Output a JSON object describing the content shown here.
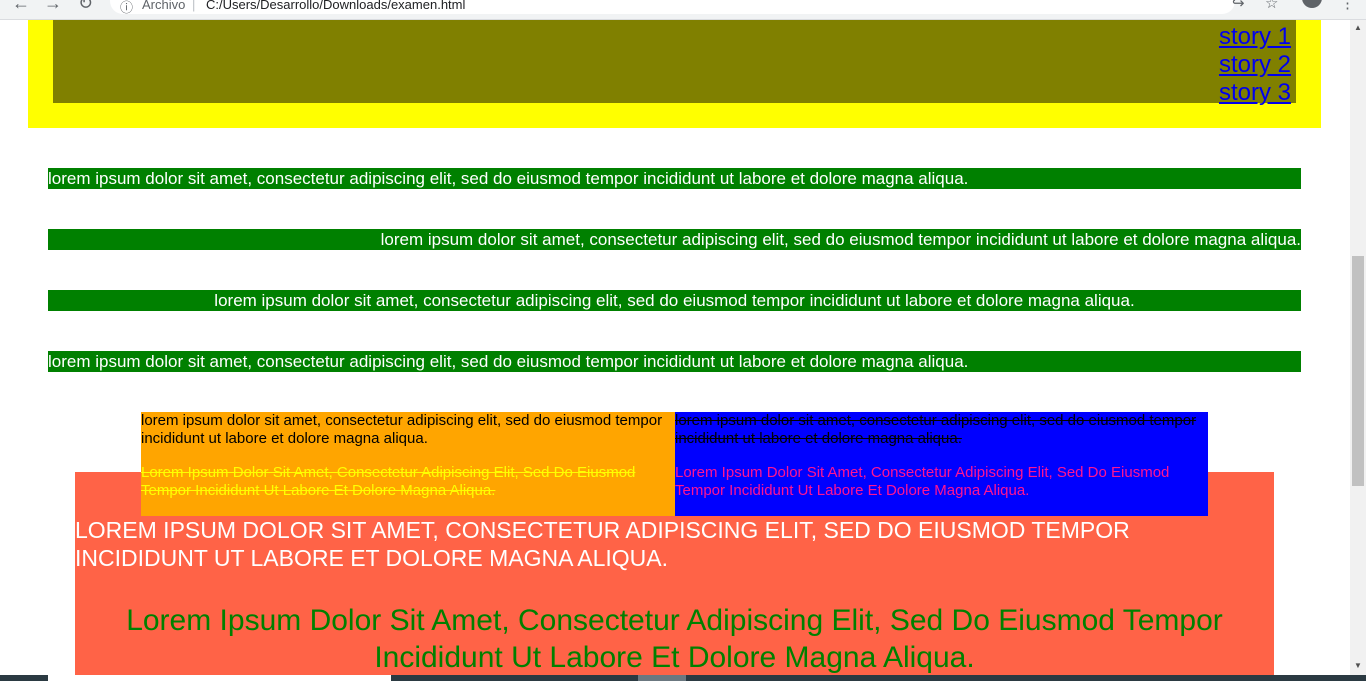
{
  "browser": {
    "back_icon": "←",
    "forward_icon": "→",
    "reload_icon": "↻",
    "info_icon": "ⓘ",
    "address_label": "Archivo",
    "address_separator": "|",
    "url": "C:/Users/Desarrollo/Downloads/examen.html",
    "share_icon": "↪",
    "star_icon": "☆",
    "menu_icon": "⋮"
  },
  "header": {
    "links": [
      "story 1",
      "story 2",
      "story 3"
    ]
  },
  "paragraphs": {
    "bar_left": "lorem ipsum dolor sit amet, consectetur adipiscing elit, sed do eiusmod tempor incididunt ut labore et dolore magna aliqua.",
    "bar_right": "lorem ipsum dolor sit amet, consectetur adipiscing elit, sed do eiusmod tempor incididunt ut labore et dolore magna aliqua.",
    "bar_center": "lorem ipsum dolor sit amet, consectetur adipiscing elit, sed do eiusmod tempor incididunt ut labore et dolore magna aliqua.",
    "bar_justify": "lorem ipsum dolor sit amet, consectetur adipiscing elit, sed do eiusmod tempor incididunt ut labore et dolore magna aliqua."
  },
  "orange_box": {
    "text": "lorem ipsum dolor sit amet, consectetur adipiscing elit, sed do eiusmod tempor incididunt ut labore et dolore magna aliqua.",
    "text_capitalized": "lorem ipsum dolor sit amet, consectetur adipiscing elit, sed do eiusmod tempor incididunt ut labore et dolore magna aliqua."
  },
  "blue_box": {
    "text": "lorem ipsum dolor sit amet, consectetur adipiscing elit, sed do eiusmod tempor incididunt ut labore et dolore magna aliqua.",
    "text_capitalized": "lorem ipsum dolor sit amet, consectetur adipiscing elit, sed do eiusmod tempor incididunt ut labore et dolore magna aliqua."
  },
  "red_box": {
    "uppercase_text": "lorem ipsum dolor sit amet, consectetur adipiscing elit, sed do eiusmod tempor incididunt ut labore et dolore magna aliqua.",
    "capitalized_text": "lorem ipsum dolor sit amet, consectetur adipiscing elit, sed do eiusmod tempor incididunt ut labore et dolore magna aliqua."
  },
  "colors": {
    "header_band": "#ffff00",
    "header_inner": "#808000",
    "bar": "#008000",
    "orange": "#ffa500",
    "blue": "#0000ff",
    "tomato": "#ff6347"
  }
}
